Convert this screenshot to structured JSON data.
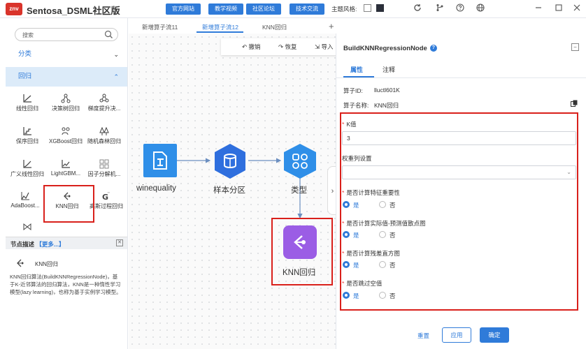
{
  "app": {
    "logo_text": "znv",
    "title": "Sentosa_DSML社区版",
    "top_buttons": [
      "官方网站",
      "教学视频",
      "社区论坛",
      "技术交流"
    ],
    "theme_label": "主题风格:",
    "theme_colors": [
      "#ffffff",
      "#2b2f3a"
    ]
  },
  "left_panel": {
    "search_placeholder": "搜索",
    "category_label": "分类",
    "section_label": "回归",
    "nodes": [
      {
        "label": "线性回归",
        "icon": "linear-regression-icon"
      },
      {
        "label": "决策树回归",
        "icon": "decision-tree-icon"
      },
      {
        "label": "梯度提升决...",
        "icon": "gradient-boost-icon"
      },
      {
        "label": "保序回归",
        "icon": "isotonic-regression-icon"
      },
      {
        "label": "XGBoost回归",
        "icon": "xgboost-icon"
      },
      {
        "label": "随机森林回归",
        "icon": "random-forest-icon"
      },
      {
        "label": "广义线性回归",
        "icon": "glm-icon"
      },
      {
        "label": "LightGBM...",
        "icon": "lightgbm-icon"
      },
      {
        "label": "因子分解机...",
        "icon": "factorization-machine-icon"
      },
      {
        "label": "AdaBoost...",
        "icon": "adaboost-icon"
      },
      {
        "label": "KNN回归",
        "icon": "knn-icon"
      },
      {
        "label": "高斯过程回归",
        "icon": "gaussian-process-icon"
      }
    ],
    "desc_title": "节点描述",
    "desc_more": "【更多...】",
    "desc_node_name": "KNN回归",
    "desc_text": "KNN回归算法(BuildKNNRegressionNode)，基于K-近邻算法的回归算法，KNN是一种惰性学习模型(lazy learning)，也称为基于实例学习模型。"
  },
  "tabs": [
    "新增算子流11",
    "新增算子流12",
    "KNN回归"
  ],
  "tab_active_index": 1,
  "toolbar": {
    "undo": "撤销",
    "redo": "恢复",
    "import": "导入"
  },
  "flow": {
    "nodes": [
      "winequality",
      "样本分区",
      "类型",
      "KNN回归"
    ]
  },
  "right_panel": {
    "title": "BuildKNNRegressionNode",
    "tabs": [
      "属性",
      "注释"
    ],
    "operator_id_label": "算子ID:",
    "operator_id": "lluctl601K",
    "operator_name_label": "算子名称:",
    "operator_name": "KNN回归",
    "k_label": "K值",
    "k_value": "3",
    "weight_label": "权重列设置",
    "q1": "是否计算特征重要性",
    "q2": "是否计算实际值-预测值散点图",
    "q3": "是否计算残差直方图",
    "q4": "是否跳过空值",
    "yes": "是",
    "no": "否",
    "buttons": {
      "reset": "重置",
      "apply": "应用",
      "ok": "确定"
    }
  }
}
